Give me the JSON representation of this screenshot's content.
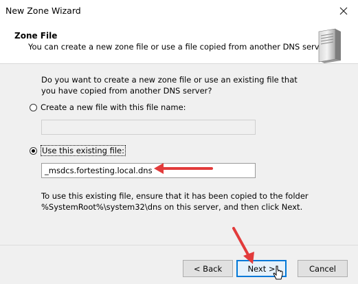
{
  "window": {
    "title": "New Zone Wizard"
  },
  "header": {
    "title": "Zone File",
    "subtitle": "You can create a new zone file or use a file copied from another DNS server."
  },
  "content": {
    "question": "Do you want to create a new zone file or use an existing file that you have copied from another DNS server?",
    "option_new": {
      "label": "Create a new file with this file name:",
      "selected": false,
      "value": ""
    },
    "option_existing": {
      "label": "Use this existing file:",
      "selected": true,
      "value": "_msdcs.fortesting.local.dns"
    },
    "note": "To use this existing file, ensure that it has been copied to the folder %SystemRoot%\\system32\\dns on this server, and then click Next."
  },
  "footer": {
    "back_label": "< Back",
    "next_label": "Next >",
    "cancel_label": "Cancel"
  },
  "colors": {
    "annotation_arrow": "#e23b3b",
    "primary_border": "#0078d7"
  }
}
